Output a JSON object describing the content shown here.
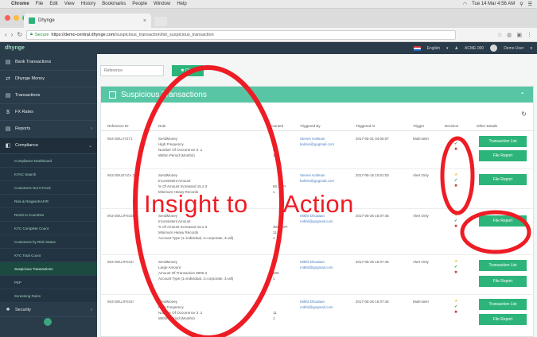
{
  "menubar": {
    "app": "Chrome",
    "items": [
      "File",
      "Edit",
      "View",
      "History",
      "Bookmarks",
      "People",
      "Window",
      "Help"
    ],
    "clock": "Tue 14 Mar 4:56 AM"
  },
  "browser": {
    "tab_title": "Dhynge",
    "secure_label": "Secure",
    "url_host": "https://demo-central.dhynge.com",
    "url_path": "/suspicious_transaction/list_suspicious_transaction"
  },
  "header": {
    "logo": "dhynge",
    "language": "English",
    "account": "ACME 000",
    "user": "Demo User"
  },
  "sidebar": {
    "items": [
      {
        "label": "Bank Transactions",
        "icon": "bank-icon"
      },
      {
        "label": "Dhynge Money",
        "icon": "money-icon"
      },
      {
        "label": "Transactions",
        "icon": "transactions-icon"
      },
      {
        "label": "FX Rates",
        "icon": "dollar-icon"
      },
      {
        "label": "Reports",
        "icon": "reports-icon"
      },
      {
        "label": "Compliance",
        "icon": "compliance-icon"
      }
    ],
    "sub_items": [
      "Compliance Dashboard",
      "KYAC Search",
      "Customers Not KYCed",
      "Risk & Ringen/KAFIR",
      "Remit to Countries",
      "KYC Complete Count",
      "Customers by Risk Status",
      "KYC Total Count",
      "Suspicious Transactions",
      "PEP",
      "Screening Rules"
    ],
    "security": {
      "label": "Security",
      "icon": "security-icon"
    }
  },
  "filter": {
    "reference_placeholder": "Reference",
    "clear_label": "Clear"
  },
  "panel": {
    "title": "Suspicious Transactions",
    "columns": [
      "Reference ID",
      "Rule",
      "Counted",
      "Triggered By",
      "Triggered At",
      "Trigger",
      "Decision",
      "Other Details"
    ]
  },
  "rows": [
    {
      "ref": "963-DBUJYZ71",
      "rules": [
        "SendMoney",
        "High Frequency",
        "Number Of Occurrence 3 .1",
        "Within Period (Months)"
      ],
      "counts": [
        "",
        "",
        "37",
        "1"
      ],
      "triggered_by": [
        "Steven Kallman",
        "kalmin@gogmail.com"
      ],
      "at": "2017-06-31 04:05:07",
      "trigger": "Multi-alert",
      "buttons": [
        "Transaction List",
        "File Report"
      ]
    },
    {
      "ref": "963-DBUEYZA.2",
      "rules": [
        "SendMoney",
        "Inconsistent Amount",
        "% Of Amount Increased 15.2.3",
        "Minimum Heavy Records"
      ],
      "counts": [
        "",
        "",
        "60.3KPI",
        "1"
      ],
      "triggered_by": [
        "Steven Kallman",
        "kalmin@gogmail.com"
      ],
      "at": "2017-06-15 10:51:03",
      "trigger": "Alert Only",
      "buttons": [
        "File Report"
      ]
    },
    {
      "ref": "963-DBUJFK02I",
      "rules": [
        "SendMoney",
        "Inconsistent Amount",
        "% Of Amount Increased 15.2.3",
        "Minimum Heavy Records",
        "Account Type (1=individual, 2=corporate, 3=all)"
      ],
      "counts": [
        "",
        "",
        "301.6KPI",
        "11",
        "1"
      ],
      "triggered_by": [
        "Mikhil Dhudaan",
        "mikhil@gogmail.com"
      ],
      "at": "2017-06-26 16:07:45",
      "trigger": "Alert Only",
      "buttons": [
        "File Report"
      ]
    },
    {
      "ref": "963-DBUJFK02I",
      "rules": [
        "SendMoney",
        "Large Amount",
        "Amount Of Transaction 8000.3",
        "Account Type (1=individual, 2=corporate, 3=all)"
      ],
      "counts": [
        "",
        "",
        "500",
        "1"
      ],
      "triggered_by": [
        "Mikhil Dhudaan",
        "mikhil@gogmail.com"
      ],
      "at": "2017-06-26 16:07:45",
      "trigger": "Alert Only",
      "buttons": [
        "Transaction List",
        "File Report"
      ]
    },
    {
      "ref": "963-DBUJFK02I",
      "rules": [
        "SendMoney",
        "High Frequency",
        "Number Of Occurrence 3 .1",
        "Within Period (Months)"
      ],
      "counts": [
        "",
        "",
        "11",
        "1"
      ],
      "triggered_by": [
        "Mikhil Dhudaan",
        "mikhil@gogmail.com"
      ],
      "at": "2017-06-26 16:07:45",
      "trigger": "Multi-alert",
      "buttons": [
        "Transaction List",
        "File Report"
      ]
    }
  ],
  "annotation": {
    "text": "Insight to     Action",
    "color": "#ee1c24"
  }
}
